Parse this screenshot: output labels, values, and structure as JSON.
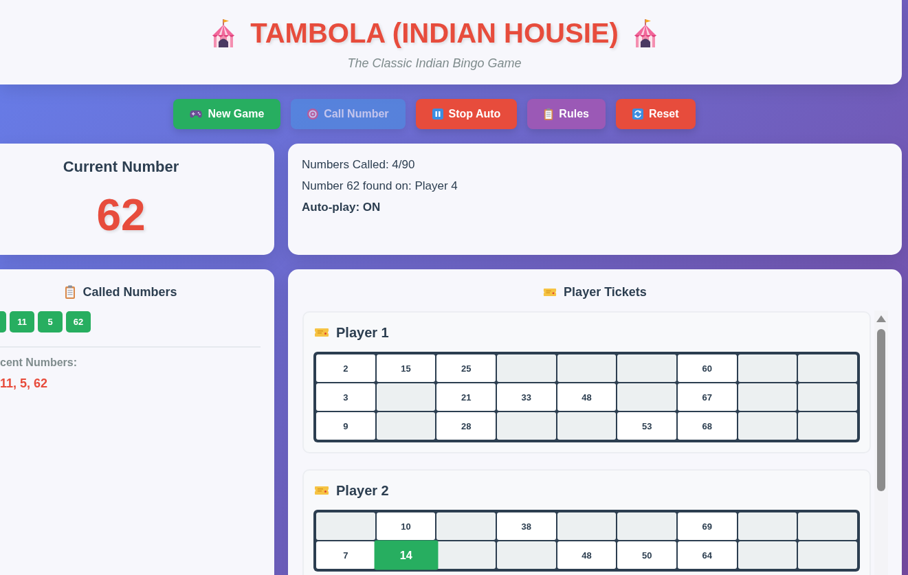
{
  "header": {
    "title": "TAMBOLA (INDIAN HOUSIE)",
    "subtitle": "The Classic Indian Bingo Game"
  },
  "controls": [
    {
      "label": "New Game",
      "kind": "new_game",
      "disabled": false
    },
    {
      "label": "Call Number",
      "kind": "call_number",
      "disabled": true
    },
    {
      "label": "Stop Auto",
      "kind": "stop_auto",
      "disabled": false
    },
    {
      "label": "Rules",
      "kind": "rules",
      "disabled": false
    },
    {
      "label": "Reset",
      "kind": "reset",
      "disabled": false
    }
  ],
  "current_number": {
    "title": "Current Number",
    "value": "62"
  },
  "status": {
    "lines": [
      {
        "text": "Numbers Called: 4/90",
        "kind": "plain"
      },
      {
        "text": "Number 62 found on: Player 4",
        "kind": "plain"
      },
      {
        "text": "Auto-play: ON",
        "kind": "bold"
      }
    ]
  },
  "called_numbers": {
    "title": "Called Numbers",
    "chips": [
      {
        "kind": "clipped"
      },
      {
        "kind": "chip",
        "number": "11"
      },
      {
        "kind": "chip",
        "number": "5"
      },
      {
        "kind": "chip",
        "number": "62"
      }
    ],
    "recent_label": "cent Numbers:",
    "recent_values": "11, 5, 62"
  },
  "tickets": {
    "title": "Player Tickets",
    "players": [
      {
        "name": "Player 1",
        "rows": [
          [
            {
              "kind": "number",
              "number": "2",
              "marked": false
            },
            {
              "kind": "number",
              "number": "15",
              "marked": false
            },
            {
              "kind": "number",
              "number": "25",
              "marked": false
            },
            {
              "kind": "blank"
            },
            {
              "kind": "blank"
            },
            {
              "kind": "blank"
            },
            {
              "kind": "number",
              "number": "60",
              "marked": false
            },
            {
              "kind": "blank"
            },
            {
              "kind": "blank"
            }
          ],
          [
            {
              "kind": "number",
              "number": "3",
              "marked": false
            },
            {
              "kind": "blank"
            },
            {
              "kind": "number",
              "number": "21",
              "marked": false
            },
            {
              "kind": "number",
              "number": "33",
              "marked": false
            },
            {
              "kind": "number",
              "number": "48",
              "marked": false
            },
            {
              "kind": "blank"
            },
            {
              "kind": "number",
              "number": "67",
              "marked": false
            },
            {
              "kind": "blank"
            },
            {
              "kind": "blank"
            }
          ],
          [
            {
              "kind": "number",
              "number": "9",
              "marked": false
            },
            {
              "kind": "blank"
            },
            {
              "kind": "number",
              "number": "28",
              "marked": false
            },
            {
              "kind": "blank"
            },
            {
              "kind": "blank"
            },
            {
              "kind": "number",
              "number": "53",
              "marked": false
            },
            {
              "kind": "number",
              "number": "68",
              "marked": false
            },
            {
              "kind": "blank"
            },
            {
              "kind": "blank"
            }
          ]
        ]
      },
      {
        "name": "Player 2",
        "rows": [
          [
            {
              "kind": "blank"
            },
            {
              "kind": "number",
              "number": "10",
              "marked": false
            },
            {
              "kind": "blank"
            },
            {
              "kind": "number",
              "number": "38",
              "marked": false
            },
            {
              "kind": "blank"
            },
            {
              "kind": "blank"
            },
            {
              "kind": "number",
              "number": "69",
              "marked": false
            },
            {
              "kind": "blank"
            },
            {
              "kind": "blank"
            }
          ],
          [
            {
              "kind": "number",
              "number": "7",
              "marked": false
            },
            {
              "kind": "number",
              "number": "14",
              "marked": true
            },
            {
              "kind": "blank"
            },
            {
              "kind": "blank"
            },
            {
              "kind": "number",
              "number": "48",
              "marked": false
            },
            {
              "kind": "number",
              "number": "50",
              "marked": false
            },
            {
              "kind": "number",
              "number": "64",
              "marked": false
            },
            {
              "kind": "blank"
            },
            {
              "kind": "blank"
            }
          ]
        ]
      }
    ]
  }
}
